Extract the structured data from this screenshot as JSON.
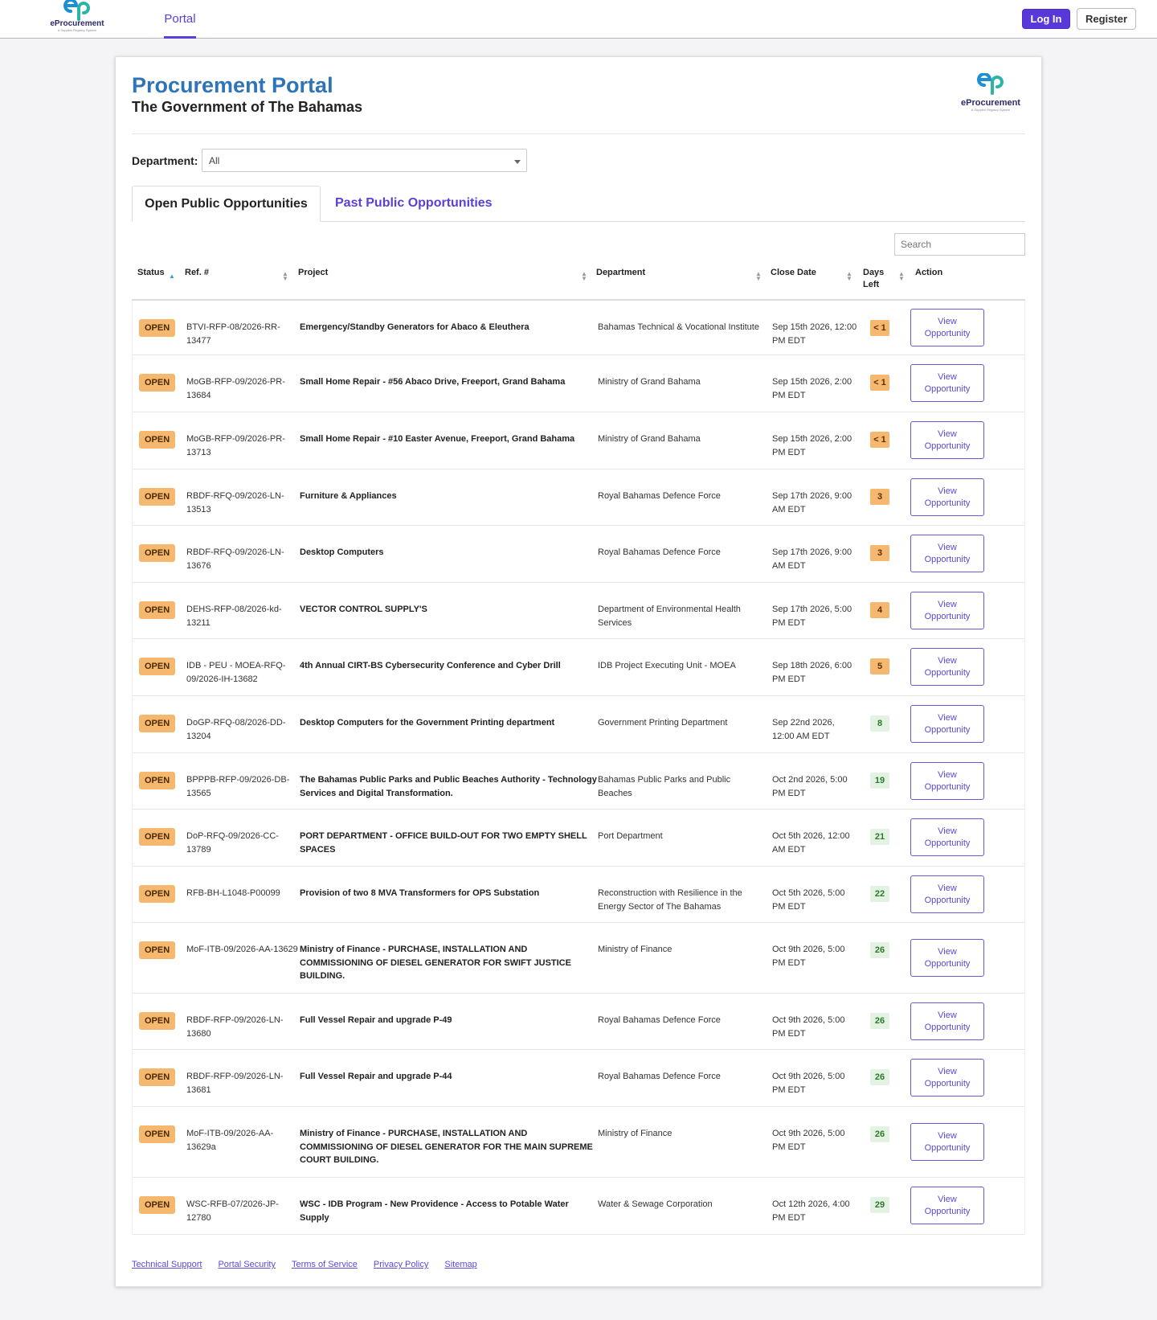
{
  "nav": {
    "logo_word": "eProcurement",
    "logo_tagline": "A Supplier Registry System",
    "portal_tab": "Portal",
    "login": "Log In",
    "register": "Register"
  },
  "header": {
    "title": "Procurement Portal",
    "subtitle": "The Government of The Bahamas",
    "logo_word": "eProcurement",
    "logo_tagline": "A Supplier Registry System"
  },
  "filter": {
    "label": "Department:",
    "value": "All"
  },
  "tabs": [
    {
      "label": "Open Public Opportunities"
    },
    {
      "label": "Past Public Opportunities"
    }
  ],
  "search": {
    "placeholder": "Search"
  },
  "columns": {
    "status": "Status",
    "ref": "Ref. #",
    "project": "Project",
    "department": "Department",
    "close_date": "Close Date",
    "days_left_1": "Days",
    "days_left_2": "Left",
    "action": "Action"
  },
  "action_label_1": "View",
  "action_label_2": "Opportunity",
  "rows": [
    {
      "status": "OPEN",
      "ref": "BTVI-RFP-08/2026-RR-13477",
      "project": "Emergency/Standby Generators for Abaco & Eleuthera",
      "department": "Bahamas Technical & Vocational Institute",
      "close": "Sep 15th 2026, 12:00 PM EDT",
      "days": "< 1",
      "urgent": true,
      "h": 68
    },
    {
      "status": "OPEN",
      "ref": "MoGB-RFP-09/2026-PR-13684",
      "project": "Small Home Repair - #56 Abaco Drive, Freeport, Grand Bahama",
      "department": "Ministry of Grand Bahama",
      "close": "Sep 15th 2026, 2:00 PM EDT",
      "days": "< 1",
      "urgent": true,
      "h": 71
    },
    {
      "status": "OPEN",
      "ref": "MoGB-RFP-09/2026-PR-13713",
      "project": "Small Home Repair - #10 Easter Avenue, Freeport, Grand Bahama",
      "department": "Ministry of Grand Bahama",
      "close": "Sep 15th 2026, 2:00 PM EDT",
      "days": "< 1",
      "urgent": true,
      "h": 71
    },
    {
      "status": "OPEN",
      "ref": "RBDF-RFQ-09/2026-LN-13513",
      "project": "Furniture & Appliances",
      "department": "Royal Bahamas Defence Force",
      "close": "Sep 17th 2026, 9:00 AM EDT",
      "days": "3",
      "urgent": true,
      "h": 70
    },
    {
      "status": "OPEN",
      "ref": "RBDF-RFQ-09/2026-LN-13676",
      "project": "Desktop Computers",
      "department": "Royal Bahamas Defence Force",
      "close": "Sep 17th 2026, 9:00 AM EDT",
      "days": "3",
      "urgent": true,
      "h": 71
    },
    {
      "status": "OPEN",
      "ref": "DEHS-RFP-08/2026-kd-13211",
      "project": "VECTOR CONTROL SUPPLY'S",
      "department": "Department of Environmental Health Services",
      "close": "Sep 17th 2026, 5:00 PM EDT",
      "days": "4",
      "urgent": true,
      "h": 70
    },
    {
      "status": "OPEN",
      "ref": "IDB - PEU - MOEA-RFQ-09/2026-IH-13682",
      "project": "4th Annual CIRT-BS Cybersecurity Conference and Cyber Drill",
      "department": "IDB Project Executing Unit - MOEA",
      "close": "Sep 18th 2026, 6:00 PM EDT",
      "days": "5",
      "urgent": true,
      "h": 71
    },
    {
      "status": "OPEN",
      "ref": "DoGP-RFQ-08/2026-DD-13204",
      "project": "Desktop Computers for the Government Printing department",
      "department": "Government Printing Department",
      "close": "Sep 22nd 2026, 12:00 AM EDT",
      "days": "8",
      "urgent": false,
      "h": 71
    },
    {
      "status": "OPEN",
      "ref": "BPPPB-RFP-09/2026-DB-13565",
      "project": "The Bahamas Public Parks and Public Beaches Authority - Technology Services and Digital Transformation.",
      "department": "Bahamas Public Parks and Public Beaches",
      "close": "Oct 2nd 2026, 5:00 PM EDT",
      "days": "19",
      "urgent": false,
      "h": 70
    },
    {
      "status": "OPEN",
      "ref": "DoP-RFQ-09/2026-CC-13789",
      "project": "PORT DEPARTMENT - OFFICE BUILD-OUT FOR TWO EMPTY SHELL SPACES",
      "department": "Port Department",
      "close": "Oct 5th 2026, 12:00 AM EDT",
      "days": "21",
      "urgent": false,
      "h": 71
    },
    {
      "status": "OPEN",
      "ref": "RFB-BH-L1048-P00099",
      "project": "Provision of two 8 MVA Transformers for OPS Substation",
      "department": "Reconstruction with Resilience in the Energy Sector of The Bahamas",
      "close": "Oct 5th 2026, 5:00 PM EDT",
      "days": "22",
      "urgent": false,
      "h": 70
    },
    {
      "status": "OPEN",
      "ref": "MoF-ITB-09/2026-AA-13629",
      "project": "Ministry of Finance - PURCHASE, INSTALLATION AND COMMISSIONING OF DIESEL GENERATOR FOR SWIFT JUSTICE BUILDING.",
      "department": "Ministry of Finance",
      "close": "Oct 9th 2026, 5:00 PM EDT",
      "days": "26",
      "urgent": false,
      "h": 88
    },
    {
      "status": "OPEN",
      "ref": "RBDF-RFP-09/2026-LN-13680",
      "project": "Full Vessel Repair and upgrade P-49",
      "department": "Royal Bahamas Defence Force",
      "close": "Oct 9th 2026, 5:00 PM EDT",
      "days": "26",
      "urgent": false,
      "h": 70
    },
    {
      "status": "OPEN",
      "ref": "RBDF-RFP-09/2026-LN-13681",
      "project": "Full Vessel Repair and upgrade P-44",
      "department": "Royal Bahamas Defence Force",
      "close": "Oct 9th 2026, 5:00 PM EDT",
      "days": "26",
      "urgent": false,
      "h": 71
    },
    {
      "status": "OPEN",
      "ref": "MoF-ITB-09/2026-AA-13629a",
      "project": "Ministry of Finance - PURCHASE, INSTALLATION AND COMMISSIONING OF DIESEL GENERATOR FOR THE MAIN SUPREME COURT BUILDING.",
      "department": "Ministry of Finance",
      "close": "Oct 9th 2026, 5:00 PM EDT",
      "days": "26",
      "urgent": false,
      "h": 88
    },
    {
      "status": "OPEN",
      "ref": "WSC-RFB-07/2026-JP-12780",
      "project": "WSC - IDB Program - New Providence - Access to Potable Water Supply",
      "department": "Water & Sewage Corporation",
      "close": "Oct 12th 2026, 4:00 PM EDT",
      "days": "29",
      "urgent": false,
      "h": 71
    }
  ],
  "footer": {
    "links": [
      "Technical Support",
      "Portal Security",
      "Terms of Service",
      "Privacy Policy",
      "Sitemap"
    ]
  },
  "colors": {
    "brand_blue": "#2e74b8",
    "accent_purple": "#5838d8",
    "open_badge": "#f6b86e",
    "days_ok_bg": "#e3f2e3",
    "days_ok_fg": "#2a7a2a"
  }
}
